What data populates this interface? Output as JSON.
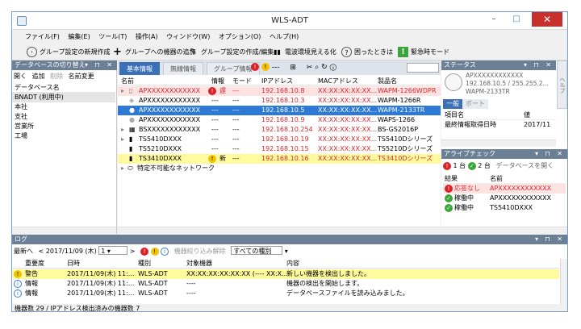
{
  "window": {
    "title": "WLS-ADT",
    "min": "–",
    "max": "□",
    "close": "✕"
  },
  "menu": [
    "ファイル(F)",
    "編集(E)",
    "ツール(T)",
    "操作(A)",
    "ウィンドウ(W)",
    "オプション(O)",
    "ヘルプ(H)"
  ],
  "toolbar": {
    "new_group": "グループ設定の新規作成",
    "add_device": "グループへの機器の追加",
    "edit_group": "グループ設定の作成/編集",
    "radio": "電波環境見える化",
    "help": "困ったときは",
    "emergency": "緊急時モード"
  },
  "left": {
    "header": "データベースの切り替え",
    "tools": [
      "開く",
      "追加",
      "削除",
      "名前変更"
    ],
    "items": [
      "データベース名",
      "BNADT (利用中)",
      "本社",
      "支社",
      "営業所",
      "工場"
    ]
  },
  "center": {
    "tabs": [
      "基本情報",
      "無線情報",
      "グループ情報"
    ],
    "columns": [
      "名前",
      "情報",
      "モード",
      "IPアドレス",
      "MACアドレス",
      "製品名"
    ],
    "rows": [
      {
        "name": "APXXXXXXXXXXXX",
        "info": "遅",
        "mode": "---",
        "ip": "192.168.10.8",
        "mac": "XX:XX:XX:XX:XX...",
        "product": "WAPM-1266WDPR",
        "style": "pink"
      },
      {
        "name": "APXXXXXXXXXXXX",
        "info": "---",
        "mode": "---",
        "ip": "192.168.10.3",
        "mac": "XX:XX:XX:XX:XX...",
        "product": "WAPM-1266R",
        "style": ""
      },
      {
        "name": "APXXXXXXXXXXXX",
        "info": "---",
        "mode": "---",
        "ip": "192.168.10.5",
        "mac": "XX:XX:XX:XX:XX...",
        "product": "WAPM-2133TR",
        "style": "blue"
      },
      {
        "name": "APXXXXXXXXXXXX",
        "info": "---",
        "mode": "---",
        "ip": "192.168.10.9",
        "mac": "XX:XX:XX:XX:XX...",
        "product": "WAPS-1266",
        "style": ""
      },
      {
        "name": "BSXXXXXXXXXXXX",
        "info": "---",
        "mode": "---",
        "ip": "192.168.10.254",
        "mac": "XX:XX:XX:XX:XX...",
        "product": "BS-GS2016P",
        "style": ""
      },
      {
        "name": "TS5410DXXX",
        "info": "---",
        "mode": "---",
        "ip": "192.168.10.19",
        "mac": "XX:XX:XX:XX:XX...",
        "product": "TS5410Dシリーズ",
        "style": ""
      },
      {
        "name": "TS5210DXXX",
        "info": "---",
        "mode": "---",
        "ip": "192.168.10.15",
        "mac": "XX:XX:XX:XX:XX...",
        "product": "TS5210Dシリーズ",
        "style": ""
      },
      {
        "name": "TS3410DXXX",
        "info": "新",
        "mode": "---",
        "ip": "192.168.10.16",
        "mac": "XX:XX:XX:XX:XX...",
        "product": "TS3410Dシリーズ",
        "style": "yellow"
      },
      {
        "name": "特定不可能なネットワーク",
        "info": "",
        "mode": "",
        "ip": "",
        "mac": "",
        "product": "",
        "style": ""
      }
    ]
  },
  "status_panel": {
    "header": "ステータス",
    "lines": [
      "APXXXXXXXXXXXX",
      "192.168.10.5 / 255.255.2...",
      "WAPM-2133TR"
    ],
    "tabs": [
      "一般",
      "ポート"
    ],
    "table_headers": [
      "項目名",
      "値"
    ],
    "table_rows": [
      [
        "最終情報取得日時",
        "2017/11"
      ]
    ]
  },
  "alive": {
    "header": "アライブチェック",
    "red_count": "1 台",
    "green_count": "2 台",
    "db_button": "データベースを開く",
    "columns": [
      "結果",
      "名前"
    ],
    "rows": [
      {
        "result": "応答なし",
        "name": "APXXXXXXXXXXXX",
        "status": "red"
      },
      {
        "result": "稼働中",
        "name": "APXXXXXXXXXXXX",
        "status": "green"
      },
      {
        "result": "稼働中",
        "name": "TS5410DXXX",
        "status": "green"
      }
    ]
  },
  "log": {
    "header": "ログ",
    "latest": "最新へ",
    "date": "2017/11/09 (木)",
    "page": "1",
    "filter_clear": "機器絞り込み解除",
    "type_select": "すべての種別",
    "columns": [
      "重要度",
      "日時",
      "種別",
      "対象機器",
      "内容"
    ],
    "rows": [
      {
        "level": "警告",
        "date": "2017/11/09(木) 11:...",
        "type": "WLS-ADT",
        "target": "XX:XX:XX:XX:XX:XX (---- XX:X...",
        "content": "新しい機器を検出しました。",
        "style": "yellow"
      },
      {
        "level": "情報",
        "date": "2017/11/09(木) 11:...",
        "type": "WLS-ADT",
        "target": "----",
        "content": "機器の検出を開始します。",
        "style": ""
      },
      {
        "level": "情報",
        "date": "2017/11/09(木) 11:...",
        "type": "WLS-ADT",
        "target": "----",
        "content": "データベースファイルを読み込みました。",
        "style": ""
      }
    ]
  },
  "statusbar": "機器数 29 / IPアドレス検出済みの機器数 7",
  "side_tab": "ヘルプ"
}
